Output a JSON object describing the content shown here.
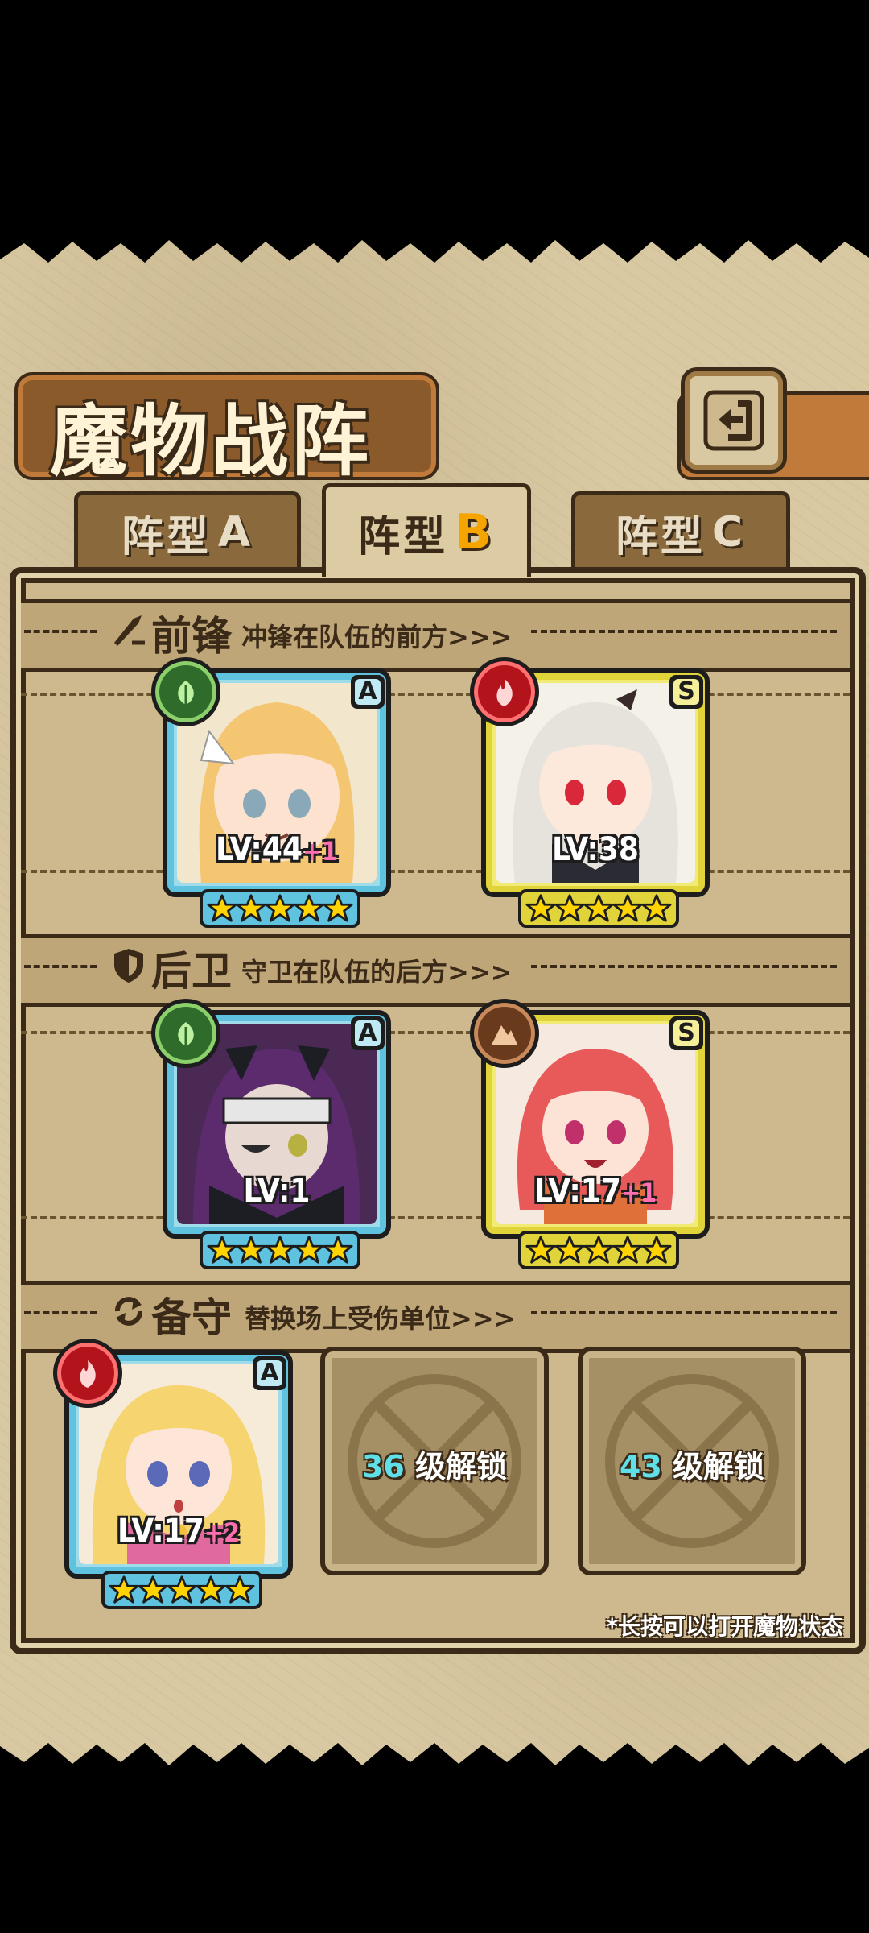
{
  "header": {
    "title": "魔物战阵",
    "back_icon": "back-arrow-icon"
  },
  "tabs": [
    {
      "label": "阵型",
      "suffix": "A",
      "active": false
    },
    {
      "label": "阵型",
      "suffix": "B",
      "active": true
    },
    {
      "label": "阵型",
      "suffix": "C",
      "active": false
    }
  ],
  "sections": {
    "front": {
      "icon": "sword-icon",
      "name": "前锋",
      "desc": "冲锋在队伍的前方>>>"
    },
    "back": {
      "icon": "shield-icon",
      "name": "后卫",
      "desc": "守卫在队伍的后方>>>"
    },
    "reserve": {
      "icon": "swap-icon",
      "name": "备守",
      "desc": "替换场上受伤单位>>>"
    }
  },
  "units": {
    "front1": {
      "rank": "A",
      "element": "grass",
      "lv": "LV:44",
      "plus": "+1",
      "stars": 5
    },
    "front2": {
      "rank": "S",
      "element": "fire",
      "lv": "LV:38",
      "plus": "",
      "stars": 5
    },
    "back1": {
      "rank": "A",
      "element": "grass",
      "lv": "LV:1",
      "plus": "",
      "stars": 5
    },
    "back2": {
      "rank": "S",
      "element": "rock",
      "lv": "LV:17",
      "plus": "+1",
      "stars": 5
    },
    "reserve1": {
      "rank": "A",
      "element": "fire",
      "lv": "LV:17",
      "plus": "+2",
      "stars": 5
    }
  },
  "locked": {
    "slot1": {
      "level": "36",
      "text": "级解锁"
    },
    "slot2": {
      "level": "43",
      "text": "级解锁"
    }
  },
  "hint": "*长按可以打开魔物状态",
  "colors": {
    "accent_gold": "#f5a400",
    "panel": "#cdb98d",
    "rank_a": "#5fc3e0",
    "rank_s": "#e1d43a",
    "lock_number": "#5fe0e8"
  }
}
